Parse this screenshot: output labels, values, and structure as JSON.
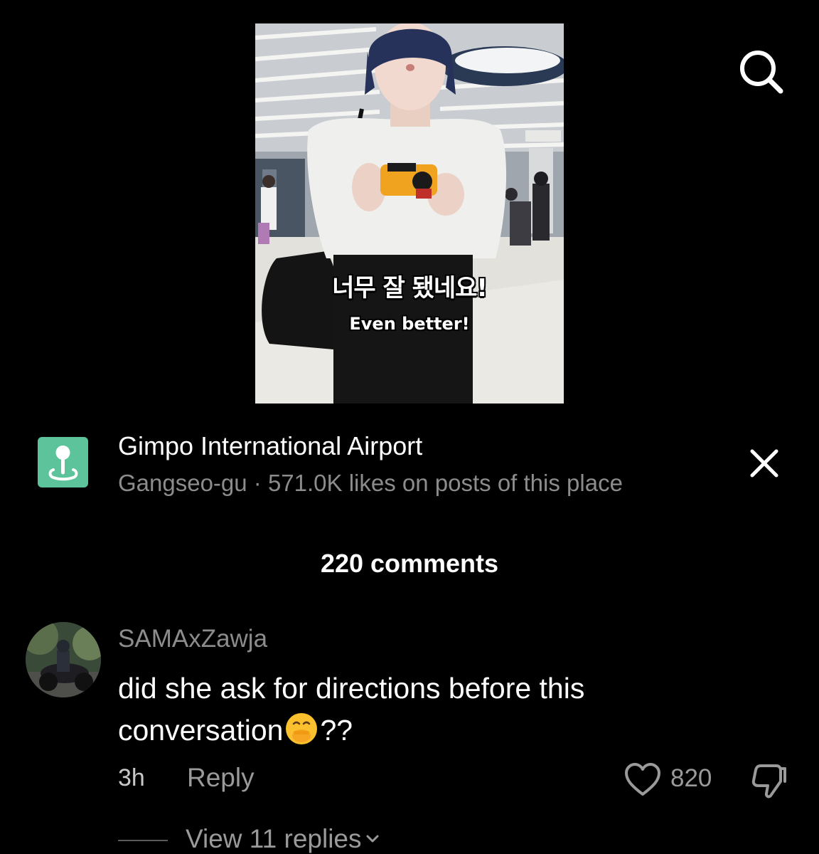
{
  "video": {
    "caption_korean": "너무 잘 됐네요!",
    "caption_english": "Even better!"
  },
  "search": {
    "icon": "search-icon"
  },
  "place": {
    "icon": "location-pin-icon",
    "icon_color": "#5cc39a",
    "name": "Gimpo International Airport",
    "meta": "Gangseo-gu · 571.0K likes on posts of this place",
    "close_icon": "close-icon"
  },
  "comments": {
    "count_label": "220 comments",
    "items": [
      {
        "username": "SAMAxZawja",
        "text_before_emoji": "did she ask for directions before this conversation",
        "emoji": "face-with-hand-over-mouth",
        "text_after_emoji": "??",
        "time": "3h",
        "reply_label": "Reply",
        "like_count": "820",
        "view_replies_label": "View 11 replies"
      }
    ]
  }
}
